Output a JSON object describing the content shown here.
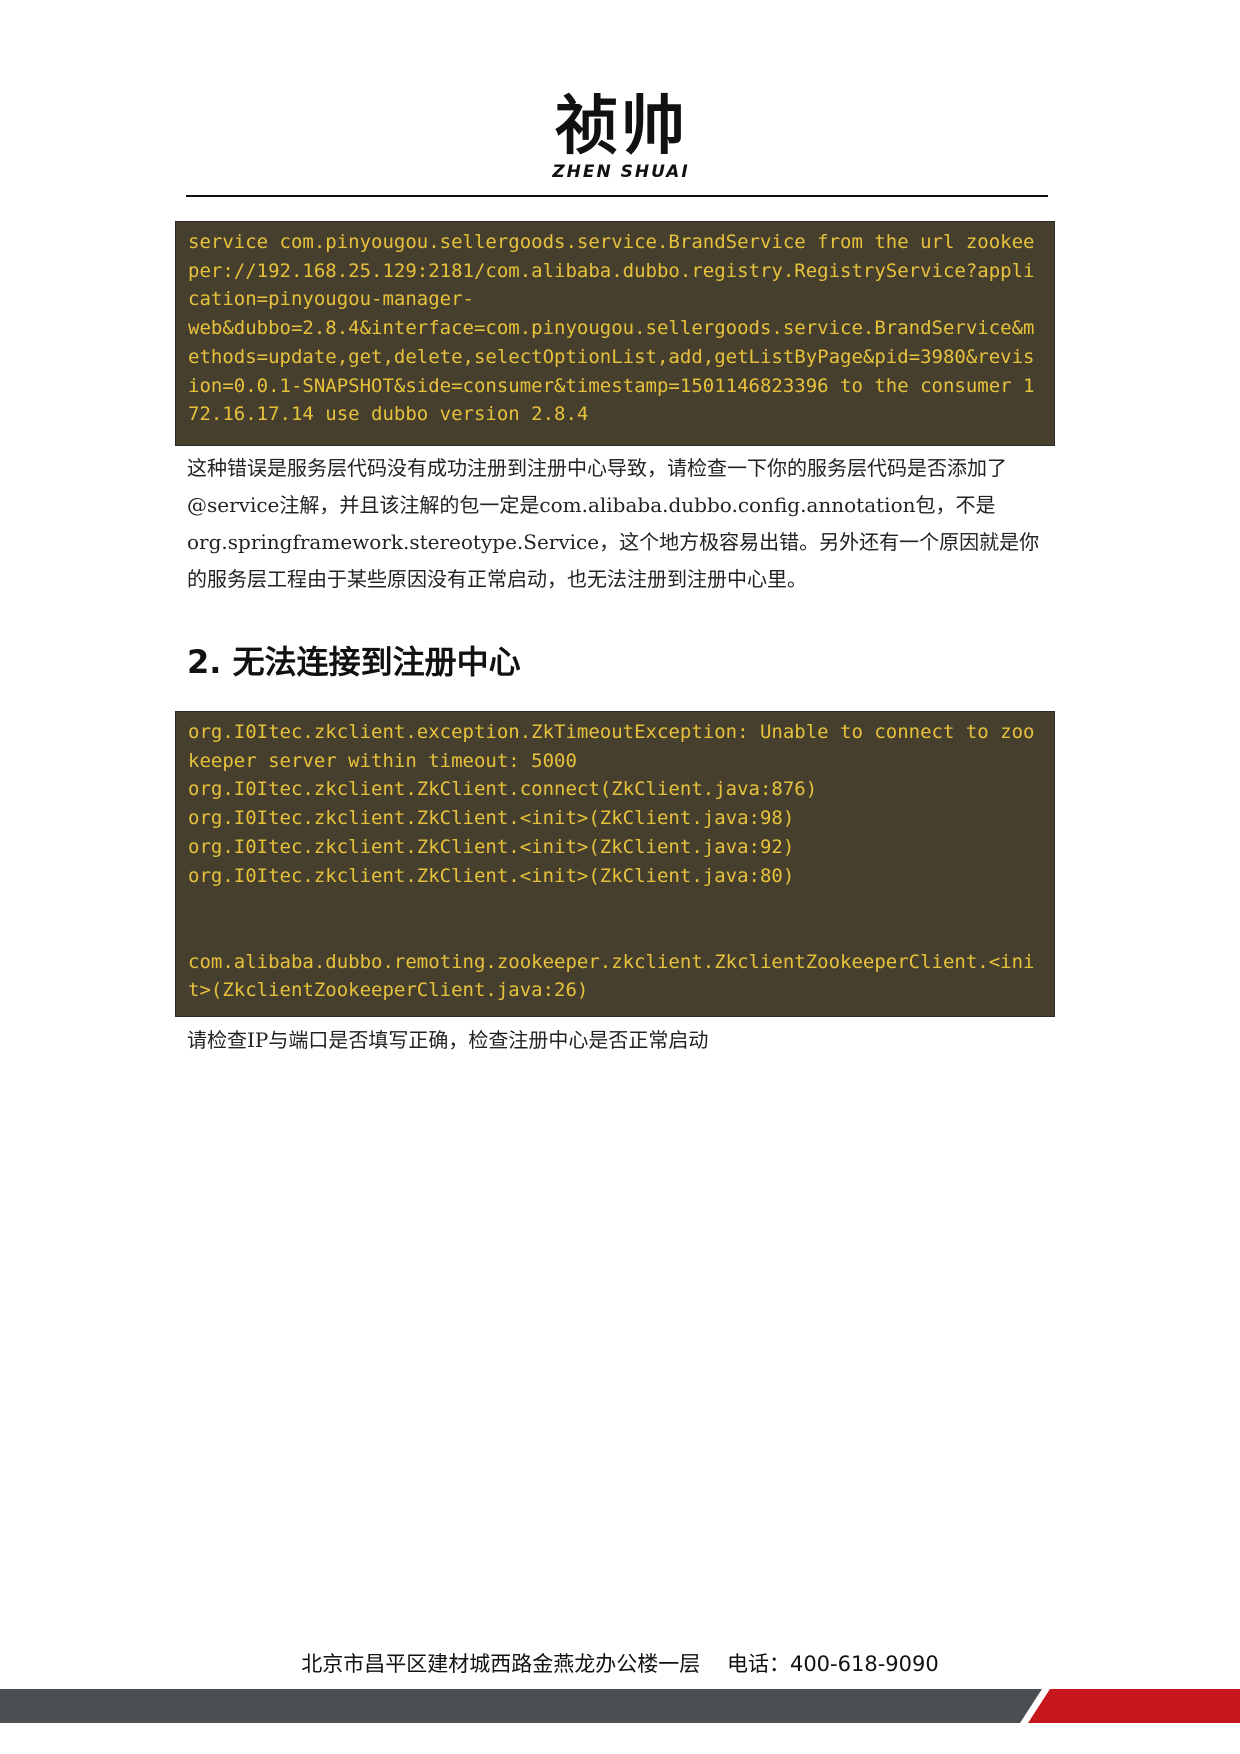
{
  "header": {
    "logo_cn": "祯帅",
    "logo_en": "ZHEN SHUAI"
  },
  "code_block_1": {
    "lines": [
      "service com.pinyougou.sellergoods.service.BrandService from the url zookeeper://192.168.25.129:2181/com.alibaba.dubbo.registry.RegistryService?application=pinyougou-manager-",
      "web&dubbo=2.8.4&interface=com.pinyougou.sellergoods.service.BrandService&methods=update,get,delete,selectOptionList,add,getListByPage&pid=3980&revision=0.0.1-SNAPSHOT&side=consumer&timestamp=1501146823396 to the consumer 172.16.17.14 use dubbo version 2.8.4"
    ]
  },
  "paragraph_1": "这种错误是服务层代码没有成功注册到注册中心导致，请检查一下你的服务层代码是否添加了@service注解，并且该注解的包一定是com.alibaba.dubbo.config.annotation包，不是org.springframework.stereotype.Service，这个地方极容易出错。另外还有一个原因就是你的服务层工程由于某些原因没有正常启动，也无法注册到注册中心里。",
  "section_heading": "2. 无法连接到注册中心",
  "code_block_2": {
    "lines": [
      "org.I0Itec.zkclient.exception.ZkTimeoutException: Unable to connect to zookeeper server within timeout: 5000",
      "org.I0Itec.zkclient.ZkClient.connect(ZkClient.java:876)",
      "org.I0Itec.zkclient.ZkClient.<init>(ZkClient.java:98)",
      "org.I0Itec.zkclient.ZkClient.<init>(ZkClient.java:92)",
      "org.I0Itec.zkclient.ZkClient.<init>(ZkClient.java:80)",
      "",
      "",
      "com.alibaba.dubbo.remoting.zookeeper.zkclient.ZkclientZookeeperClient.<init>(ZkclientZookeeperClient.java:26)"
    ]
  },
  "paragraph_2": "请检查IP与端口是否填写正确，检查注册中心是否正常启动",
  "footer": {
    "address": "北京市昌平区建材城西路金燕龙办公楼一层",
    "phone": "电话：400-618-9090"
  },
  "colors": {
    "code_background": "#473f2d",
    "code_text": "#e6c23c",
    "footer_bar_dark": "#4a4f52",
    "footer_bar_red": "#c8161d"
  }
}
